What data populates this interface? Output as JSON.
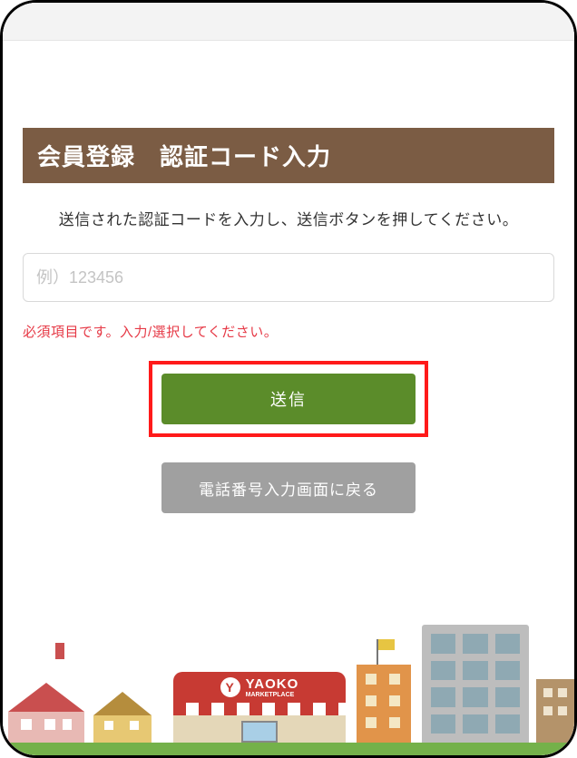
{
  "header": {
    "title": "会員登録　認証コード入力"
  },
  "form": {
    "instruction": "送信された認証コードを入力し、送信ボタンを押してください。",
    "code_placeholder": "例）123456",
    "code_value": "",
    "error_message": "必須項目です。入力/選択してください。"
  },
  "buttons": {
    "submit_label": "送信",
    "back_label": "電話番号入力画面に戻る"
  },
  "footer": {
    "store_brand": "YAOKO",
    "store_subtitle": "MARKETPLACE"
  },
  "colors": {
    "heading_bg": "#7b5c44",
    "submit_bg": "#5b8c2a",
    "back_bg": "#a0a0a0",
    "error": "#e63946",
    "highlight_border": "#ff1a1a"
  }
}
